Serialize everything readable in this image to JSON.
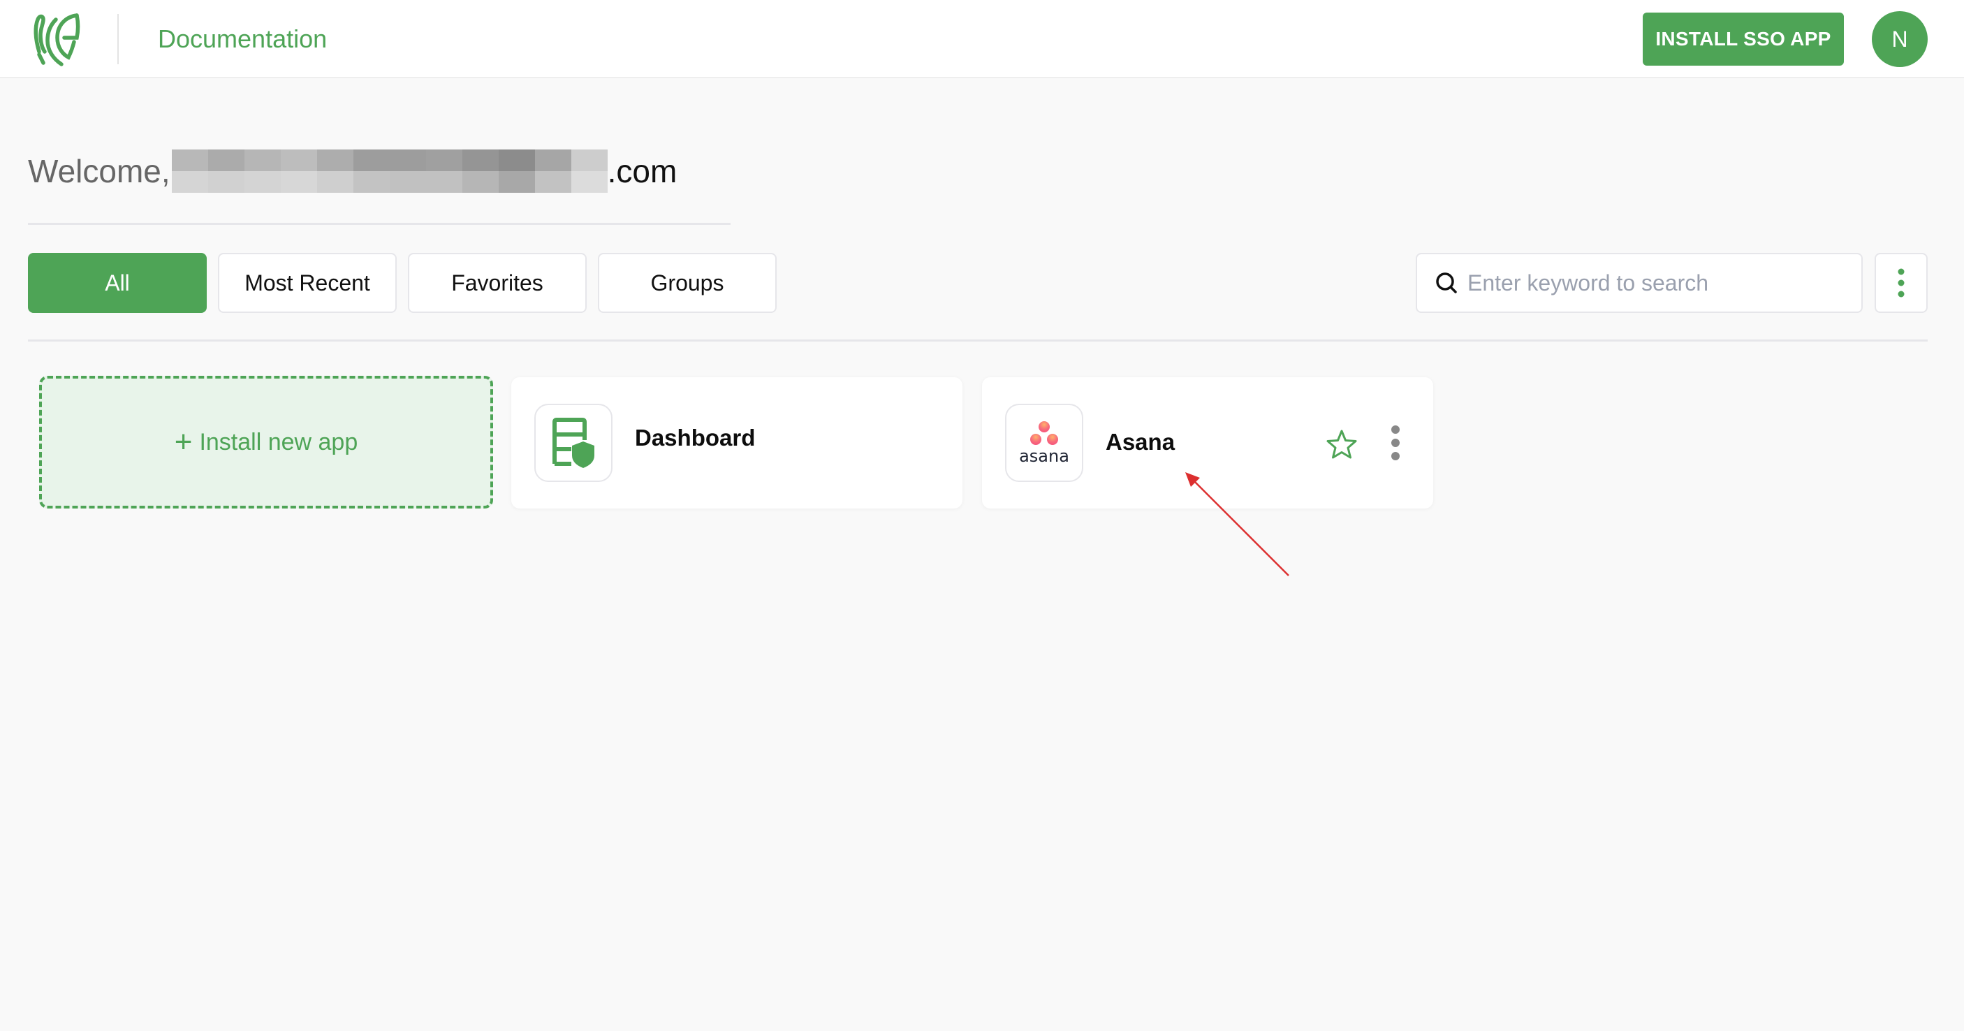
{
  "header": {
    "logo_icon": "fingerprint-shield-logo",
    "title": "Documentation",
    "install_sso_label": "INSTALL SSO APP",
    "avatar_initial": "N"
  },
  "welcome": {
    "prefix": "Welcome,",
    "redacted_email": "[redacted]",
    "suffix": ".com"
  },
  "tabs": [
    {
      "label": "All",
      "active": true
    },
    {
      "label": "Most Recent",
      "active": false
    },
    {
      "label": "Favorites",
      "active": false
    },
    {
      "label": "Groups",
      "active": false
    }
  ],
  "search": {
    "icon": "search-icon",
    "placeholder": "Enter keyword to search",
    "value": ""
  },
  "toolbar": {
    "more_icon": "vertical-ellipsis-icon"
  },
  "install_card": {
    "icon": "plus-icon",
    "label": "Install new app"
  },
  "apps": [
    {
      "name": "Dashboard",
      "icon": "dashboard-shield-icon",
      "favorite": false
    },
    {
      "name": "Asana",
      "icon": "asana-logo",
      "favorite": false,
      "logo_text": "asana",
      "has_star": true,
      "has_menu": true
    }
  ],
  "colors": {
    "brand_green": "#4ea456",
    "install_card_bg": "#e8f4ea",
    "page_bg": "#f9f9f9",
    "annotation_red": "#dc2f2f",
    "asana_coral": "#f06a6a"
  },
  "annotation": {
    "type": "arrow",
    "points_to": "Asana app card"
  }
}
